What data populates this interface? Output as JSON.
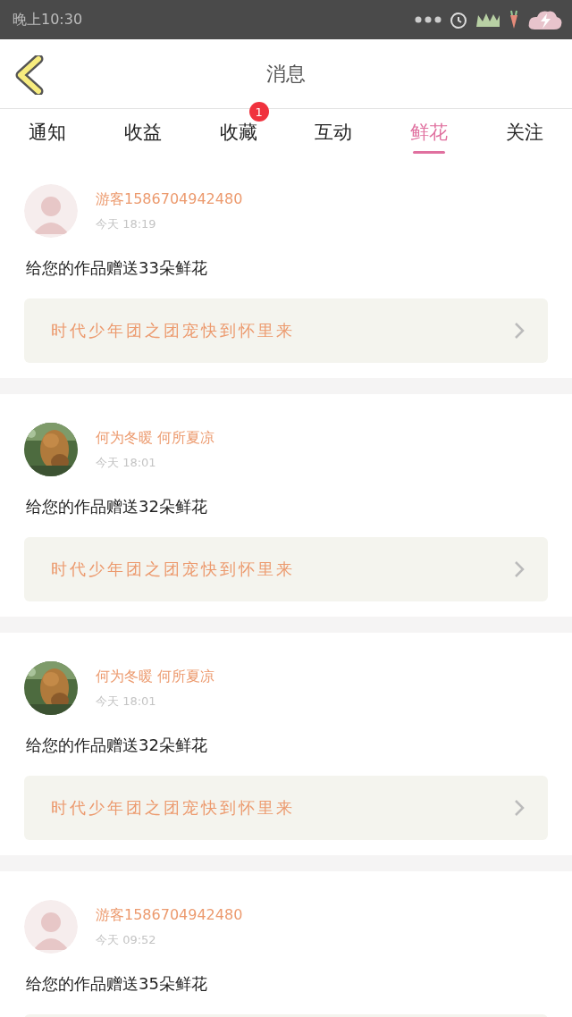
{
  "status_bar": {
    "time": "晚上10:30"
  },
  "header": {
    "title": "消息"
  },
  "tabs": [
    {
      "label": "通知",
      "selected": false
    },
    {
      "label": "收益",
      "selected": false
    },
    {
      "label": "收藏",
      "selected": false,
      "badge": "1"
    },
    {
      "label": "互动",
      "selected": false
    },
    {
      "label": "鲜花",
      "selected": true
    },
    {
      "label": "关注",
      "selected": false
    }
  ],
  "messages": [
    {
      "avatar": {
        "kind": "figure"
      },
      "name": "游客1586704942480",
      "time": "今天 18:19",
      "text": "给您的作品赠送33朵鲜花",
      "work": "时代少年团之团宠快到怀里来"
    },
    {
      "name": "何为冬暖 何所夏凉",
      "time": "今天 18:01",
      "text": "给您的作品赠送32朵鲜花",
      "work": "时代少年团之团宠快到怀里来"
    },
    {
      "name": "何为冬暖 何所夏凉",
      "time": "今天 18:01",
      "text": "给您的作品赠送32朵鲜花",
      "work": "时代少年团之团宠快到怀里来"
    },
    {
      "avatar": {
        "kind": "figure"
      },
      "name": "游客1586704942480",
      "time": "今天 09:52",
      "text": "给您的作品赠送35朵鲜花"
    }
  ]
}
